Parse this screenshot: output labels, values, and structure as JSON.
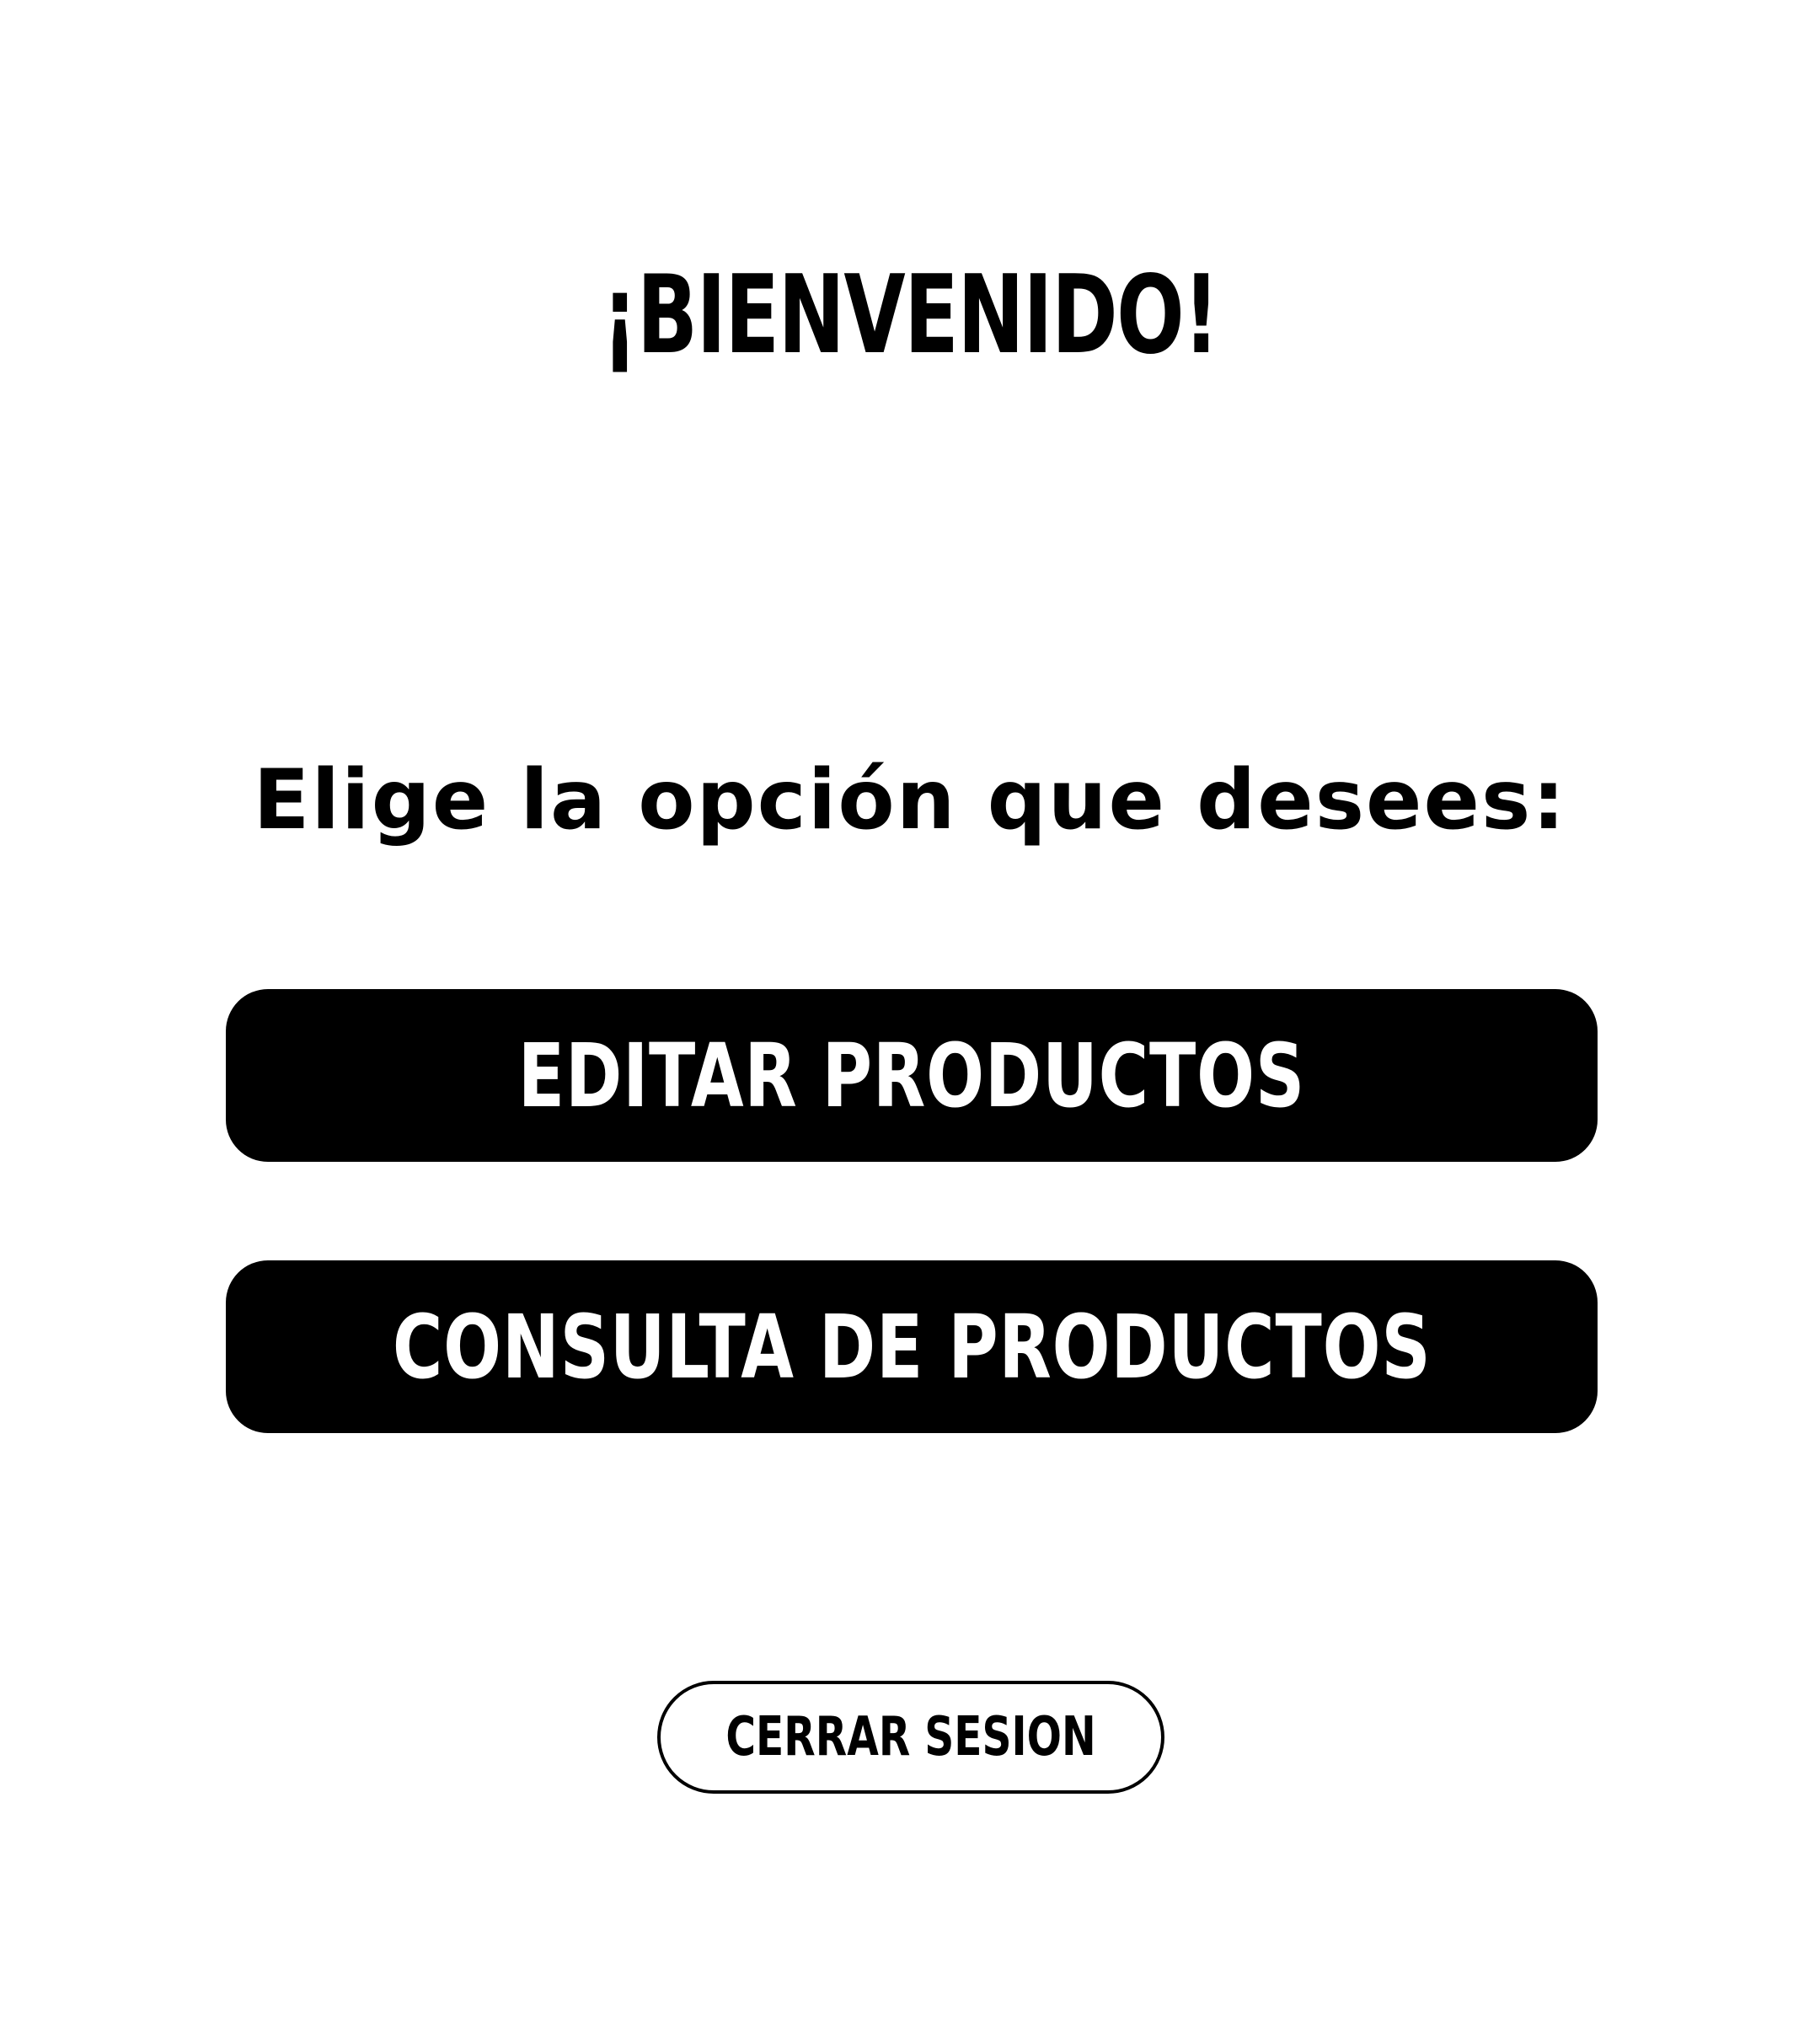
{
  "header": {
    "title": "¡BIENVENIDO!"
  },
  "prompt": {
    "text": "Elige la opción que desees:"
  },
  "actions": {
    "edit_products": "EDITAR PRODUCTOS",
    "consult_products": "CONSULTA DE PRODUCTOS"
  },
  "footer": {
    "logout": "CERRAR SESION"
  },
  "colors": {
    "background": "#ffffff",
    "primary": "#000000",
    "on_primary": "#ffffff"
  }
}
